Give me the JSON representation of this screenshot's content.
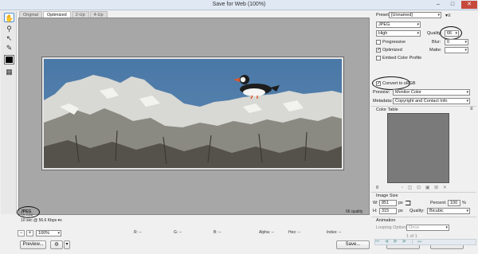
{
  "window": {
    "title": "Save for Web (100%)",
    "minimize": "–",
    "maximize": "□",
    "close": "✕"
  },
  "tools": [
    "hand",
    "zoom",
    "eyedropper",
    "eyedropper-color",
    "toggle-slices"
  ],
  "view_tabs": [
    "Original",
    "Optimized",
    "2-Up",
    "4-Up"
  ],
  "active_tab": "Optimized",
  "image_info": {
    "format": "JPEG",
    "size": "55.69K",
    "speed": "10 sec @ 56.6 Kbps",
    "quality_readout": "66 quality"
  },
  "bottom_bar": {
    "zoom": "100%",
    "readouts": [
      "R: --",
      "G: --",
      "B: --",
      "Alpha: --",
      "Hex: --",
      "Index: --"
    ]
  },
  "footer": {
    "preview": "Preview...",
    "save": "Save...",
    "cancel": "Cancel",
    "done": "Done"
  },
  "settings": {
    "preset_label": "Preset:",
    "preset_value": "[Unnamed]",
    "format_value": "JPEG",
    "compression_value": "High",
    "quality_label": "Quality:",
    "quality_value": "66",
    "progressive_label": "Progressive",
    "progressive_checked": false,
    "blur_label": "Blur:",
    "blur_value": "0",
    "optimized_label": "Optimized",
    "optimized_checked": true,
    "matte_label": "Matte:",
    "embed_label": "Embed Color Profile",
    "embed_checked": false,
    "convert_label": "Convert to sRGB",
    "convert_checked": true,
    "preview_label": "Preview:",
    "preview_value": "Monitor Color",
    "metadata_label": "Metadata:",
    "metadata_value": "Copyright and Contact Info"
  },
  "color_table": {
    "title": "Color Table",
    "color_count": "0"
  },
  "image_size": {
    "title": "Image Size",
    "w_label": "W:",
    "w_value": "851",
    "h_label": "H:",
    "h_value": "315",
    "unit": "px",
    "percent_label": "Percent:",
    "percent_value": "100",
    "percent_unit": "%",
    "quality_label": "Quality:",
    "quality_value": "Bicubic"
  },
  "animation": {
    "title": "Animation",
    "looping_label": "Looping Options:",
    "looping_value": "Once",
    "frame_counter": "1 of 1"
  }
}
